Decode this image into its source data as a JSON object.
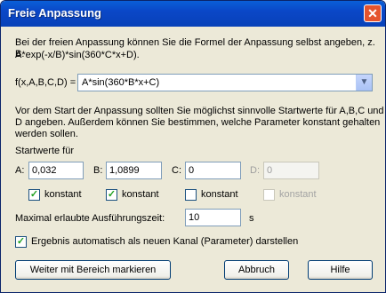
{
  "window": {
    "title": "Freie Anpassung",
    "close_label": "✕"
  },
  "intro": {
    "line1": "Bei der freien Anpassung können Sie die Formel der Anpassung selbst angeben, z. B.",
    "line2": "A*exp(-x/B)*sin(360*C*x+D)."
  },
  "formula": {
    "label": "f(x,A,B,C,D) =",
    "value": "A*sin(360*B*x+C)"
  },
  "hint": {
    "line1": "Vor dem Start der Anpassung sollten Sie möglichst sinnvolle Startwerte für A,B,C und",
    "line2": "D angeben. Außerdem können Sie bestimmen, welche Parameter konstant gehalten",
    "line3": "werden sollen."
  },
  "start_values": {
    "heading": "Startwerte für",
    "params": [
      {
        "label": "A:",
        "value": "0,032",
        "const_label": "konstant",
        "const_checked": true,
        "enabled": true
      },
      {
        "label": "B:",
        "value": "1,0899",
        "const_label": "konstant",
        "const_checked": true,
        "enabled": true
      },
      {
        "label": "C:",
        "value": "0",
        "const_label": "konstant",
        "const_checked": false,
        "enabled": true
      },
      {
        "label": "D:",
        "value": "0",
        "const_label": "konstant",
        "const_checked": false,
        "enabled": false
      }
    ]
  },
  "runtime": {
    "label": "Maximal erlaubte Ausführungszeit:",
    "value": "10",
    "unit": "s"
  },
  "result_option": {
    "label": "Ergebnis automatisch als neuen Kanal (Parameter) darstellen",
    "checked": true
  },
  "buttons": {
    "continue": "Weiter mit Bereich markieren",
    "cancel": "Abbruch",
    "help": "Hilfe"
  }
}
